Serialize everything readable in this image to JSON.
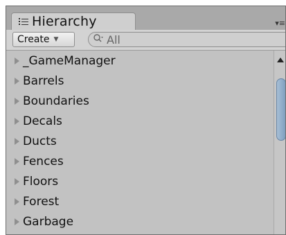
{
  "panel": {
    "tab": {
      "title": "Hierarchy",
      "icon": "list-icon"
    },
    "menu_icon": "▾≡"
  },
  "toolbar": {
    "create_label": "Create",
    "create_arrow": "▼",
    "search": {
      "placeholder": "All",
      "icon": "search-icon"
    }
  },
  "hierarchy": {
    "items": [
      {
        "label": "_GameManager"
      },
      {
        "label": "Barrels"
      },
      {
        "label": "Boundaries"
      },
      {
        "label": "Decals"
      },
      {
        "label": "Ducts"
      },
      {
        "label": "Fences"
      },
      {
        "label": "Floors"
      },
      {
        "label": "Forest"
      },
      {
        "label": "Garbage"
      }
    ]
  }
}
